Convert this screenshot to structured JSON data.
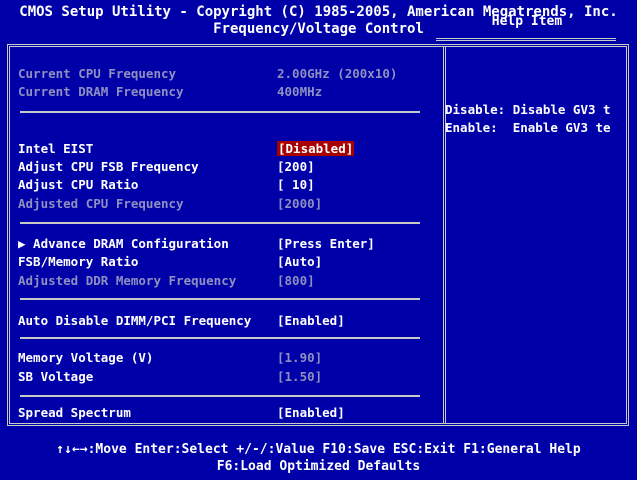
{
  "header": {
    "line1": "CMOS Setup Utility - Copyright (C) 1985-2005, American Megatrends, Inc.",
    "line2": "Frequency/Voltage Control"
  },
  "help": {
    "title": "Help Item",
    "lines": [
      "Disable: Disable GV3 t",
      "Enable:  Enable GV3 te"
    ]
  },
  "info": [
    {
      "label": "Current CPU Frequency",
      "value": "2.00GHz (200x10)"
    },
    {
      "label": "Current DRAM Frequency",
      "value": "400MHz"
    }
  ],
  "settings": [
    {
      "label": "Intel EIST",
      "value": "[Disabled]",
      "selected": true
    },
    {
      "label": "Adjust CPU FSB Frequency",
      "value": "[200]"
    },
    {
      "label": "Adjust CPU Ratio",
      "value": "[ 10]"
    },
    {
      "label": "Adjusted CPU Frequency",
      "value": "[2000]",
      "dim": true
    },
    {
      "label": "▶ Advance DRAM Configuration",
      "value": "[Press Enter]"
    },
    {
      "label": "FSB/Memory Ratio",
      "value": "[Auto]"
    },
    {
      "label": "Adjusted DDR Memory Frequency",
      "value": "[800]",
      "dim": true
    },
    {
      "label": "Auto Disable DIMM/PCI Frequency",
      "value": "[Enabled]"
    },
    {
      "label": "Memory Voltage (V)",
      "value": "[1.90]"
    },
    {
      "label": "SB Voltage",
      "value": "[1.50]"
    },
    {
      "label": "Spread Spectrum",
      "value": "[Enabled]"
    }
  ],
  "footer": {
    "line1": "↑↓←→:Move  Enter:Select  +/-/:Value  F10:Save  ESC:Exit  F1:General Help",
    "line2": "F6:Load Optimized Defaults"
  }
}
